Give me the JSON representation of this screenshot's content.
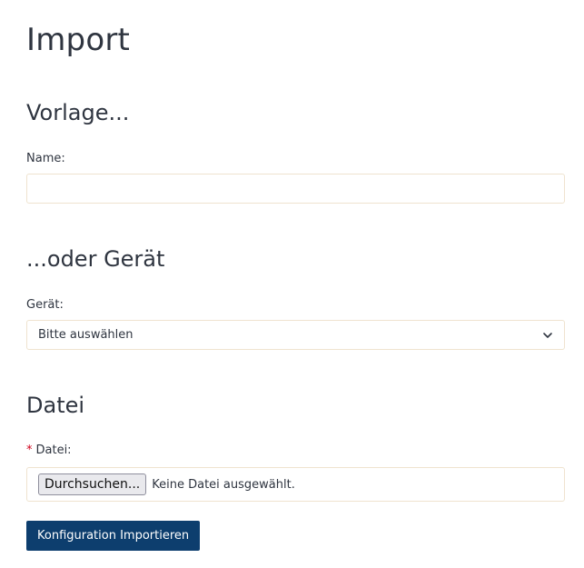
{
  "page": {
    "title": "Import"
  },
  "template_section": {
    "heading": "Vorlage...",
    "name_label": "Name:",
    "name_value": "",
    "name_placeholder": ""
  },
  "device_section": {
    "heading": "...oder Gerät",
    "device_label": "Gerät:",
    "device_selected": "Bitte auswählen"
  },
  "file_section": {
    "heading": "Datei",
    "required_marker": "*",
    "file_label": "Datei:",
    "browse_label": "Durchsuchen...",
    "file_status": "Keine Datei ausgewählt."
  },
  "actions": {
    "submit_label": "Konfiguration Importieren"
  },
  "colors": {
    "primary_button": "#0d3e6e",
    "input_border": "#efe3cf",
    "required": "#d0021b"
  }
}
